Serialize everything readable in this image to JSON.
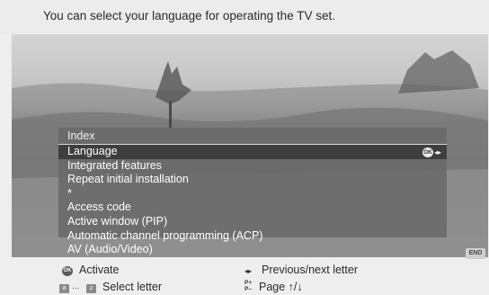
{
  "description": "You can select your language for operating the TV set.",
  "menu": {
    "title": "Index",
    "items": [
      {
        "label": "Language"
      },
      {
        "label": "Integrated features"
      },
      {
        "label": "Repeat initial installation"
      },
      {
        "label": "*"
      },
      {
        "label": "Access code"
      },
      {
        "label": "Active window (PIP)"
      },
      {
        "label": "Automatic channel programming (ACP)"
      },
      {
        "label": "AV (Audio/Video)"
      }
    ],
    "selected_index": 0,
    "ok_hint": "OK"
  },
  "end_button": "END",
  "legend": {
    "activate_key": "OK",
    "activate_label": "Activate",
    "prev_next_label": "Previous/next letter",
    "select_key_from": "a",
    "select_key_sep": "...",
    "select_key_to": "z",
    "select_label": "Select letter",
    "page_key_plus": "P+",
    "page_key_minus": "P–",
    "page_label": "Page ↑/↓"
  },
  "colors": {
    "menu_background": "#696969",
    "selected_row": "#3e3e3e",
    "text_light": "#ffffff",
    "page_background": "#eeeeee"
  }
}
